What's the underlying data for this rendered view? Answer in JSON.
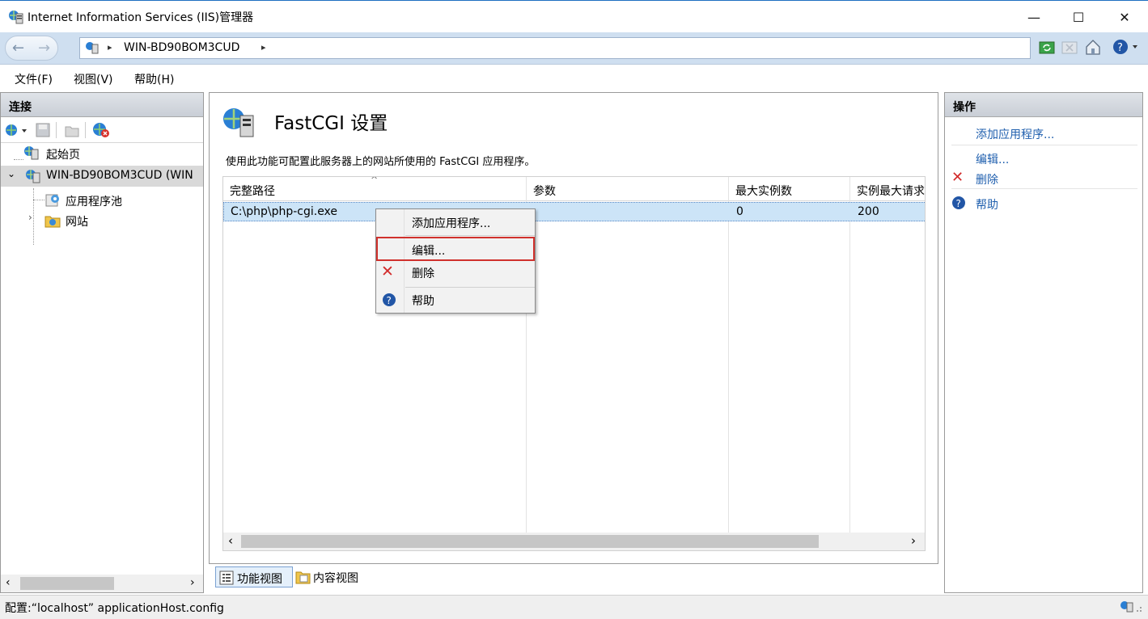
{
  "window": {
    "title": "Internet Information Services (IIS)管理器",
    "minimize": "—",
    "maximize": "☐",
    "close": "✕"
  },
  "nav": {
    "breadcrumb": "WIN-BD90BOM3CUD",
    "sep1": "▸",
    "sep2": "▸"
  },
  "menubar": {
    "file": "文件(F)",
    "view": "视图(V)",
    "help": "帮助(H)"
  },
  "connections": {
    "header": "连接",
    "tree": {
      "start": "起始页",
      "server": "WIN-BD90BOM3CUD (WIN",
      "apppools": "应用程序池",
      "sites": "网站"
    }
  },
  "main": {
    "title": "FastCGI 设置",
    "description": "使用此功能可配置此服务器上的网站所使用的 FastCGI 应用程序。",
    "columns": {
      "path": "完整路径",
      "args": "参数",
      "max_instances": "最大实例数",
      "max_requests": "实例最大请求"
    },
    "row": {
      "path": "C:\\php\\php-cgi.exe",
      "args": "",
      "max_instances": "0",
      "max_requests": "200"
    },
    "tabs": {
      "features": "功能视图",
      "content": "内容视图"
    }
  },
  "context_menu": {
    "add": "添加应用程序...",
    "edit": "编辑...",
    "delete": "删除",
    "help": "帮助"
  },
  "actions": {
    "header": "操作",
    "add": "添加应用程序...",
    "edit": "编辑...",
    "delete": "删除",
    "help": "帮助"
  },
  "status": {
    "text": "配置:“localhost” applicationHost.config"
  },
  "colors": {
    "accent": "#1f5fae",
    "selection": "#cce4f7",
    "highlight_box": "#d0312d"
  }
}
